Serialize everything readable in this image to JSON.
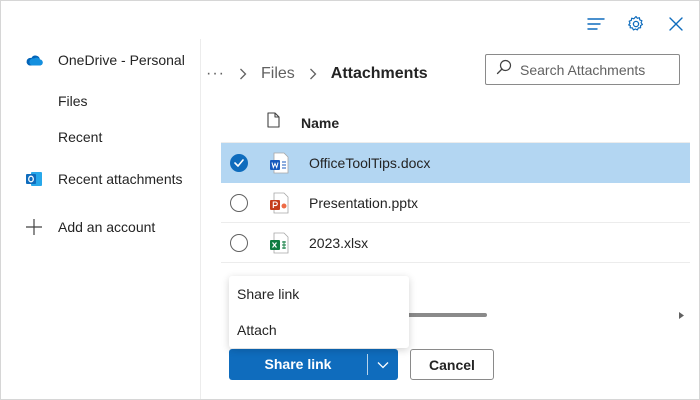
{
  "colors": {
    "accent": "#0f6cbd",
    "selected_row": "#b3d6f2",
    "onedrive": "#0364b8",
    "outlook": "#0f6cbd",
    "word": "#185abd",
    "powerpoint": "#c43e1c",
    "excel": "#107c41"
  },
  "toolbar": {
    "icons": [
      "list-icon",
      "gear-icon",
      "close-icon"
    ]
  },
  "sidebar": {
    "items": [
      {
        "label": "OneDrive - Personal",
        "icon": "onedrive-cloud-icon"
      },
      {
        "label": "Files"
      },
      {
        "label": "Recent"
      },
      {
        "label": "Recent attachments",
        "icon": "outlook-icon"
      },
      {
        "label": "Add an account",
        "icon": "plus-icon"
      }
    ]
  },
  "breadcrumb": {
    "overflow": "···",
    "parent": "Files",
    "current": "Attachments"
  },
  "search": {
    "placeholder": "Search Attachments",
    "value": ""
  },
  "list": {
    "header": {
      "name": "Name",
      "icon": "document-icon"
    },
    "rows": [
      {
        "name": "OfficeToolTips.docx",
        "icon": "word-icon",
        "selected": true
      },
      {
        "name": "Presentation.pptx",
        "icon": "powerpoint-icon",
        "selected": false
      },
      {
        "name": "2023.xlsx",
        "icon": "excel-icon",
        "selected": false
      }
    ]
  },
  "menu": {
    "items": [
      "Share link",
      "Attach"
    ]
  },
  "actions": {
    "primary_label": "Share link",
    "cancel_label": "Cancel"
  }
}
